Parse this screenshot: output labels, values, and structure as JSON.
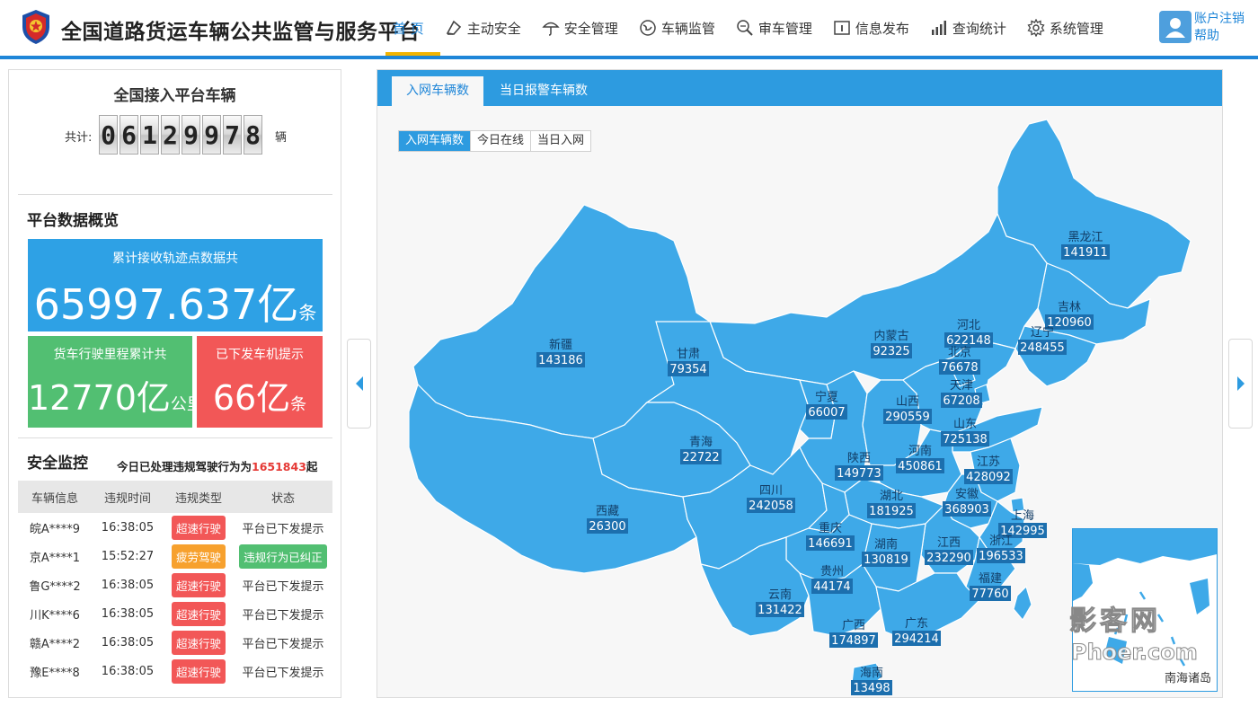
{
  "app": {
    "title": "全国道路货运车辆公共监管与服务平台"
  },
  "nav": [
    {
      "label": "首 页",
      "icon": "home-icon",
      "active": true
    },
    {
      "label": "主动安全",
      "icon": "pen-shield-icon"
    },
    {
      "label": "安全管理",
      "icon": "umbrella-icon"
    },
    {
      "label": "车辆监管",
      "icon": "globe-icon"
    },
    {
      "label": "审车管理",
      "icon": "magnifier-icon"
    },
    {
      "label": "信息发布",
      "icon": "info-board-icon"
    },
    {
      "label": "查询统计",
      "icon": "bar-chart-icon"
    },
    {
      "label": "系统管理",
      "icon": "gear-icon"
    }
  ],
  "user": {
    "logout_label": "账户注销",
    "help_label": "帮助"
  },
  "vehicles": {
    "title": "全国接入平台车辆",
    "prefix": "共计:",
    "digits": [
      "0",
      "6",
      "1",
      "2",
      "9",
      "9",
      "7",
      "8"
    ],
    "unit": "辆"
  },
  "overview": {
    "title": "平台数据概览",
    "track": {
      "label": "累计接收轨迹点数据共",
      "value": "65997.637亿",
      "unit": "条"
    },
    "mileage": {
      "label": "货车行驶里程累计共",
      "value": "12770亿",
      "unit": "公里"
    },
    "driver_alerts": {
      "label": "已下发车机提示",
      "value": "66亿",
      "unit": "条"
    },
    "colors": {
      "blue": "#2ea1e5",
      "green": "#52bf72",
      "red": "#f25757"
    }
  },
  "monitor": {
    "title": "安全监控",
    "note_prefix": "今日已处理违规驾驶行为为",
    "note_count": "1651843",
    "note_suffix": "起",
    "columns": [
      "车辆信息",
      "违规时间",
      "违规类型",
      "状态"
    ],
    "rows": [
      {
        "vehicle": "皖A****9",
        "time": "16:38:05",
        "type": "超速行驶",
        "type_color": "red",
        "status": "平台已下发提示",
        "status_badge": false
      },
      {
        "vehicle": "京A****1",
        "time": "15:52:27",
        "type": "疲劳驾驶",
        "type_color": "orange",
        "status": "违规行为已纠正",
        "status_badge": true
      },
      {
        "vehicle": "鲁G****2",
        "time": "16:38:05",
        "type": "超速行驶",
        "type_color": "red",
        "status": "平台已下发提示",
        "status_badge": false
      },
      {
        "vehicle": "川K****6",
        "time": "16:38:05",
        "type": "超速行驶",
        "type_color": "red",
        "status": "平台已下发提示",
        "status_badge": false
      },
      {
        "vehicle": "赣A****2",
        "time": "16:38:05",
        "type": "超速行驶",
        "type_color": "red",
        "status": "平台已下发提示",
        "status_badge": false
      },
      {
        "vehicle": "豫E****8",
        "time": "16:38:05",
        "type": "超速行驶",
        "type_color": "red",
        "status": "平台已下发提示",
        "status_badge": false
      }
    ]
  },
  "map_panel": {
    "tabs": [
      "入网车辆数",
      "当日报警车辆数"
    ],
    "subtabs": [
      "入网车辆数",
      "今日在线",
      "当日入网"
    ],
    "inset_label": "南海诸岛",
    "map_color": "#3ea9e8",
    "provinces": [
      {
        "name": "黑龙江",
        "value": "141911"
      },
      {
        "name": "吉林",
        "value": "120960"
      },
      {
        "name": "辽宁",
        "value": "248455"
      },
      {
        "name": "内蒙古",
        "value": "92325"
      },
      {
        "name": "河北",
        "value": "622148"
      },
      {
        "name": "北京",
        "value": "76678"
      },
      {
        "name": "天津",
        "value": "67208"
      },
      {
        "name": "新疆",
        "value": "143186"
      },
      {
        "name": "甘肃",
        "value": "79354"
      },
      {
        "name": "宁夏",
        "value": "66007"
      },
      {
        "name": "山西",
        "value": "290559"
      },
      {
        "name": "山东",
        "value": "725138"
      },
      {
        "name": "青海",
        "value": "22722"
      },
      {
        "name": "陕西",
        "value": "149773"
      },
      {
        "name": "河南",
        "value": "450861"
      },
      {
        "name": "江苏",
        "value": "428092"
      },
      {
        "name": "西藏",
        "value": "26300"
      },
      {
        "name": "四川",
        "value": "242058"
      },
      {
        "name": "湖北",
        "value": "181925"
      },
      {
        "name": "安徽",
        "value": "368903"
      },
      {
        "name": "上海",
        "value": "142995"
      },
      {
        "name": "重庆",
        "value": "146691"
      },
      {
        "name": "湖南",
        "value": "130819"
      },
      {
        "name": "江西",
        "value": "232290"
      },
      {
        "name": "浙江",
        "value": "196533"
      },
      {
        "name": "贵州",
        "value": "44174"
      },
      {
        "name": "福建",
        "value": "77760"
      },
      {
        "name": "云南",
        "value": "131422"
      },
      {
        "name": "广西",
        "value": "174897"
      },
      {
        "name": "广东",
        "value": "294214"
      },
      {
        "name": "海南",
        "value": "13498"
      }
    ]
  },
  "watermark": {
    "line1": "影客网",
    "line2": "Phoer.com"
  }
}
